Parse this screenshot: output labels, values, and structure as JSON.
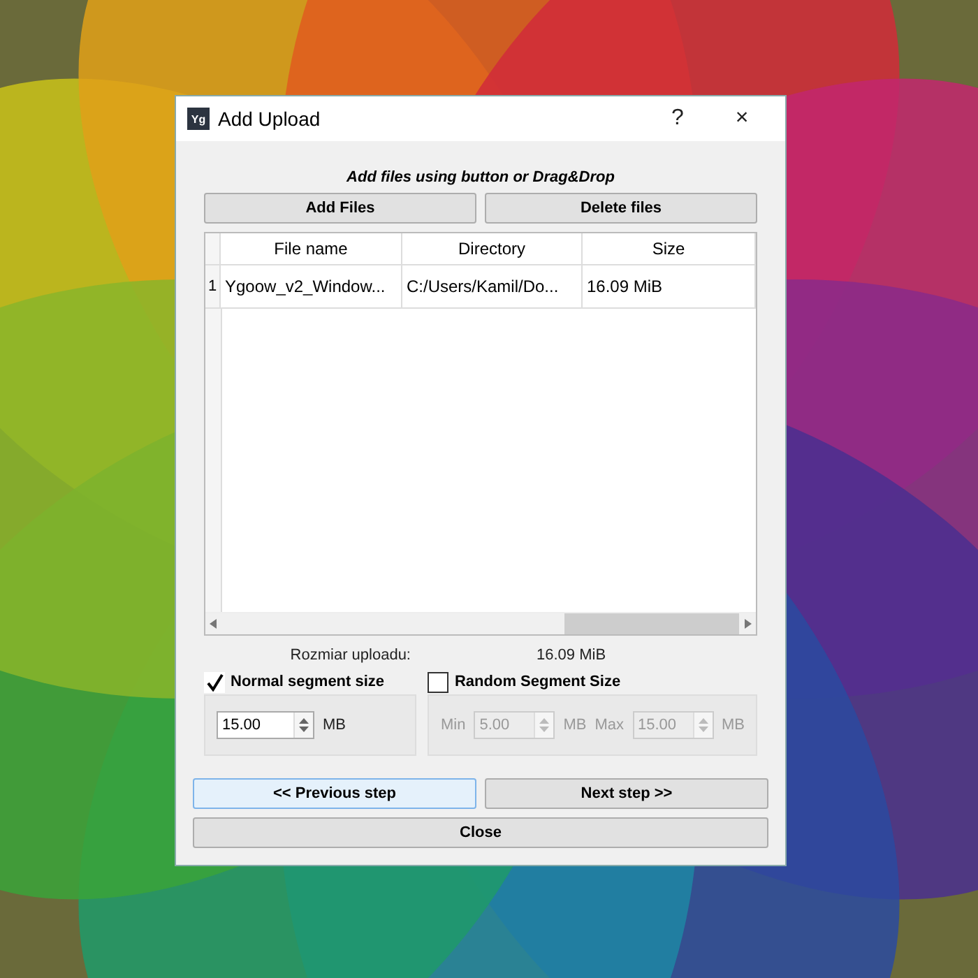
{
  "window": {
    "icon_text": "Yg",
    "title": "Add Upload",
    "help": "?",
    "close": "×"
  },
  "hint": "Add files using button or Drag&Drop",
  "file_buttons": [
    "Add Files",
    "Delete files"
  ],
  "table": {
    "columns": [
      "File name",
      "Directory",
      "Size"
    ],
    "rows": [
      {
        "index": "1",
        "cells": [
          "Ygoow_v2_Window...",
          "C:/Users/Kamil/Do...",
          "16.09 MiB"
        ]
      }
    ]
  },
  "summary": {
    "label": "Rozmiar uploadu:",
    "value": "16.09 MiB"
  },
  "normal_segment": {
    "label": "Normal segment size",
    "checked": true,
    "value": "15.00",
    "unit": "MB"
  },
  "random_segment": {
    "label": "Random Segment Size",
    "checked": false,
    "min_label": "Min",
    "min_value": "5.00",
    "min_unit": "MB",
    "max_label": "Max",
    "max_value": "15.00",
    "max_unit": "MB"
  },
  "nav_buttons": [
    {
      "label": "<< Previous step",
      "focused": true
    },
    {
      "label": "Next step >>",
      "focused": false
    }
  ],
  "close_button": "Close"
}
